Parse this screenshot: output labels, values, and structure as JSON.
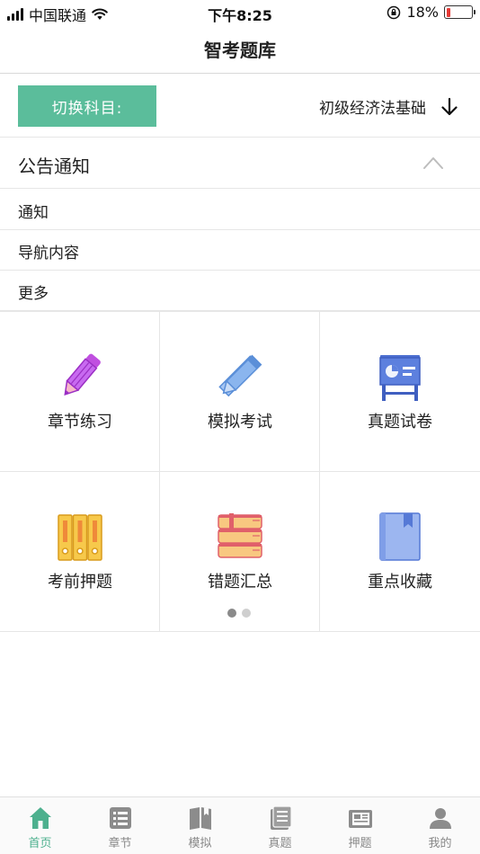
{
  "status_bar": {
    "carrier": "中国联通",
    "time": "下午8:25",
    "battery": "18%",
    "battery_level": 0.18,
    "battery_color": "#e53935"
  },
  "nav": {
    "title": "智考题库"
  },
  "subject": {
    "switch_label": "切换科目:",
    "current": "初级经济法基础",
    "accent_color": "#5bbd9b",
    "arrow_icon": "arrow-down-icon"
  },
  "notice": {
    "title": "公告通知",
    "toggle_icon": "chevron-up-icon",
    "items": [
      {
        "label": "通知"
      },
      {
        "label": "导航内容"
      },
      {
        "label": "更多"
      }
    ]
  },
  "grid": {
    "items": [
      {
        "label": "章节练习",
        "icon": "pencil-icon"
      },
      {
        "label": "模拟考试",
        "icon": "ruler-pencil-icon"
      },
      {
        "label": "真题试卷",
        "icon": "presentation-board-icon"
      },
      {
        "label": "考前押题",
        "icon": "binders-icon"
      },
      {
        "label": "错题汇总",
        "icon": "books-stack-icon"
      },
      {
        "label": "重点收藏",
        "icon": "bookmark-book-icon"
      }
    ],
    "page_count": 2,
    "active_page": 1
  },
  "tab_bar": {
    "active_color": "#4db08e",
    "items": [
      {
        "label": "首页",
        "icon": "home-icon"
      },
      {
        "label": "章节",
        "icon": "list-icon"
      },
      {
        "label": "模拟",
        "icon": "book-open-icon"
      },
      {
        "label": "真题",
        "icon": "document-icon"
      },
      {
        "label": "押题",
        "icon": "newspaper-icon"
      },
      {
        "label": "我的",
        "icon": "user-icon"
      }
    ]
  }
}
